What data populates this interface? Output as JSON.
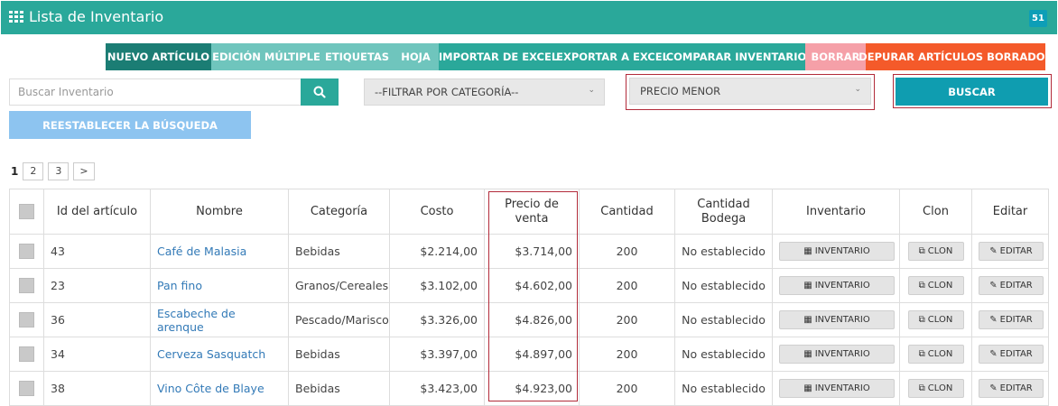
{
  "header": {
    "title": "Lista de Inventario",
    "badge": "51"
  },
  "toolbar": [
    {
      "label": "NUEVO ARTÍCULO",
      "color": "#1b7d74",
      "width": 117
    },
    {
      "label": "EDICIÓN MÚLTIPLE",
      "color": "#6fc5bd",
      "width": 122
    },
    {
      "label": "ETIQUETAS",
      "color": "#6fc5bd",
      "width": 79
    },
    {
      "label": "HOJA",
      "color": "#6fc5bd",
      "width": 51
    },
    {
      "label": "IMPORTAR DE EXCEL",
      "color": "#2aa89a",
      "width": 132
    },
    {
      "label": "EXPORTAR A EXCEL",
      "color": "#2aa89a",
      "width": 121
    },
    {
      "label": "COMPARAR INVENTARIO",
      "color": "#2aa89a",
      "width": 153
    },
    {
      "label": "BORRAR",
      "color": "#f5a0a8",
      "width": 67
    },
    {
      "label": "DEPURAR ARTÍCULOS BORRADOS",
      "color": "#f45a2a",
      "width": 199
    }
  ],
  "search": {
    "placeholder": "Buscar Inventario"
  },
  "filters": {
    "category": "--FILTRAR POR CATEGORÍA--",
    "sort": "PRECIO MENOR"
  },
  "buttons": {
    "buscar": "BUSCAR",
    "reset": "REESTABLECER LA BÚSQUEDA"
  },
  "pagination": {
    "current": "1",
    "pages": [
      "2",
      "3",
      ">"
    ]
  },
  "table": {
    "headers": {
      "id": "Id del artículo",
      "name": "Nombre",
      "category": "Categoría",
      "cost": "Costo",
      "price_l1": "Precio de",
      "price_l2": "venta",
      "qty": "Cantidad",
      "qty_bodega_l1": "Cantidad",
      "qty_bodega_l2": "Bodega",
      "inventory": "Inventario",
      "clone": "Clon",
      "edit": "Editar"
    },
    "rows": [
      {
        "id": "43",
        "name": "Café de Malasia",
        "category": "Bebidas",
        "cost": "$2.214,00",
        "price": "$3.714,00",
        "qty": "200",
        "bodega": "No establecido"
      },
      {
        "id": "23",
        "name": "Pan fino",
        "category": "Granos/Cereales",
        "cost": "$3.102,00",
        "price": "$4.602,00",
        "qty": "200",
        "bodega": "No establecido"
      },
      {
        "id": "36",
        "name": "Escabeche de arenque",
        "category": "Pescado/Marisco",
        "cost": "$3.326,00",
        "price": "$4.826,00",
        "qty": "200",
        "bodega": "No establecido"
      },
      {
        "id": "34",
        "name": "Cerveza Sasquatch",
        "category": "Bebidas",
        "cost": "$3.397,00",
        "price": "$4.897,00",
        "qty": "200",
        "bodega": "No establecido"
      },
      {
        "id": "38",
        "name": "Vino Côte de Blaye",
        "category": "Bebidas",
        "cost": "$3.423,00",
        "price": "$4.923,00",
        "qty": "200",
        "bodega": "No establecido"
      }
    ],
    "actions": {
      "inventory": "INVENTARIO",
      "clone": "CLON",
      "edit": "EDITAR"
    }
  }
}
